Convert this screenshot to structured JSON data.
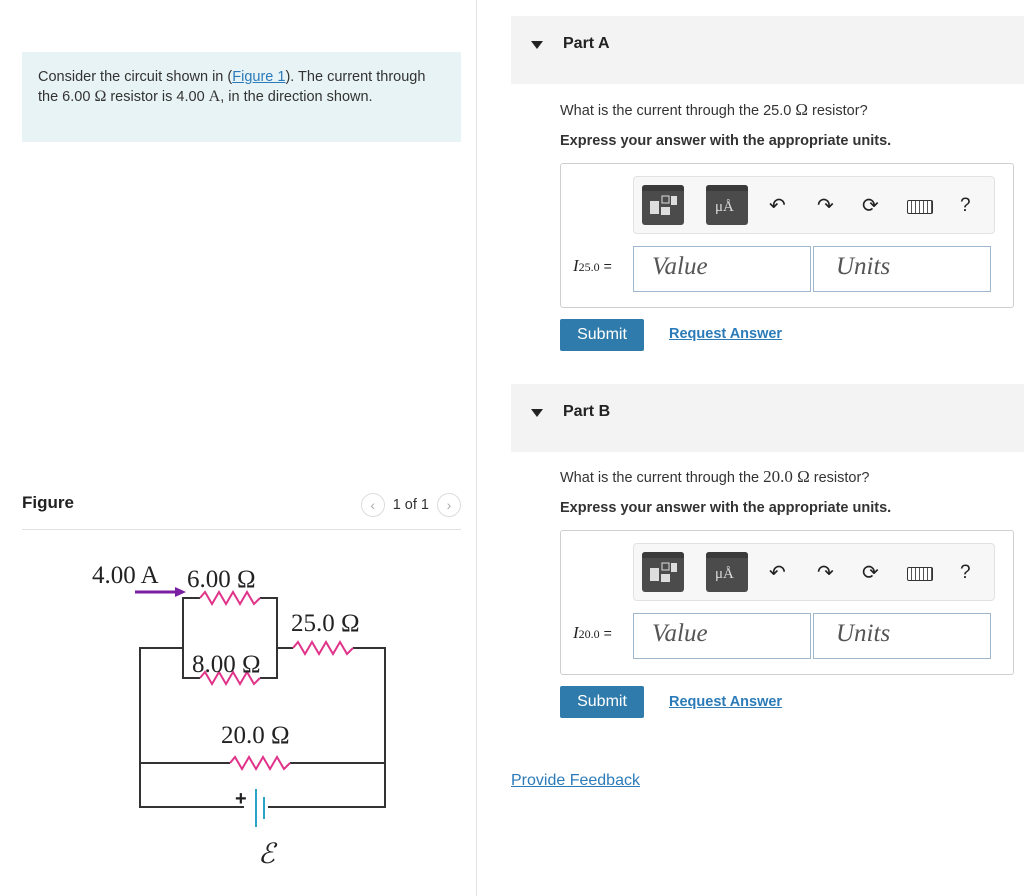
{
  "problem": {
    "intro_before": "Consider the circuit shown in (",
    "figure_link": "Figure 1",
    "intro_after": "). The current through the 6.00 ",
    "ohm_symbol": "Ω",
    "intro_mid": " resistor is 4.00 ",
    "amp_unit": "A",
    "intro_end": ", in the direction shown."
  },
  "figure": {
    "title": "Figure",
    "pager_text": "1 of 1",
    "current_label": "4.00 A",
    "r6_label": "6.00 Ω",
    "r25_label": "25.0 Ω",
    "r8_label": "8.00 Ω",
    "r20_label": "20.0 Ω",
    "battery_plus": "+",
    "emf_label": "ℰ",
    "colors": {
      "wire": "#333333",
      "resistor": "#e0338a",
      "arrow": "#7b1fa2",
      "battery": "#2aa3c9"
    }
  },
  "parts": [
    {
      "title": "Part A",
      "question_before": "What is the current through the 25.0 ",
      "question_sym": "Ω",
      "question_after": " resistor?",
      "express": "Express your answer with the appropriate units.",
      "var_main": "I",
      "var_sub": "25.0",
      "var_eq": "=",
      "value_placeholder": "Value",
      "units_placeholder": "Units",
      "submit_label": "Submit",
      "request_label": "Request Answer"
    },
    {
      "title": "Part B",
      "question_before": "What is the current through the ",
      "question_sym": "20.0 Ω",
      "question_after": " resistor?",
      "express": "Express your answer with the appropriate units.",
      "var_main": "I",
      "var_sub": "20.0",
      "var_eq": "=",
      "value_placeholder": "Value",
      "units_placeholder": "Units",
      "submit_label": "Submit",
      "request_label": "Request Answer"
    }
  ],
  "toolbar": {
    "icons": [
      "templates-icon",
      "units-icon",
      "undo-icon",
      "redo-icon",
      "reset-icon",
      "keyboard-icon",
      "help-icon"
    ],
    "units_glyph": "μÅ",
    "help_glyph": "?"
  },
  "feedback_label": "Provide Feedback"
}
